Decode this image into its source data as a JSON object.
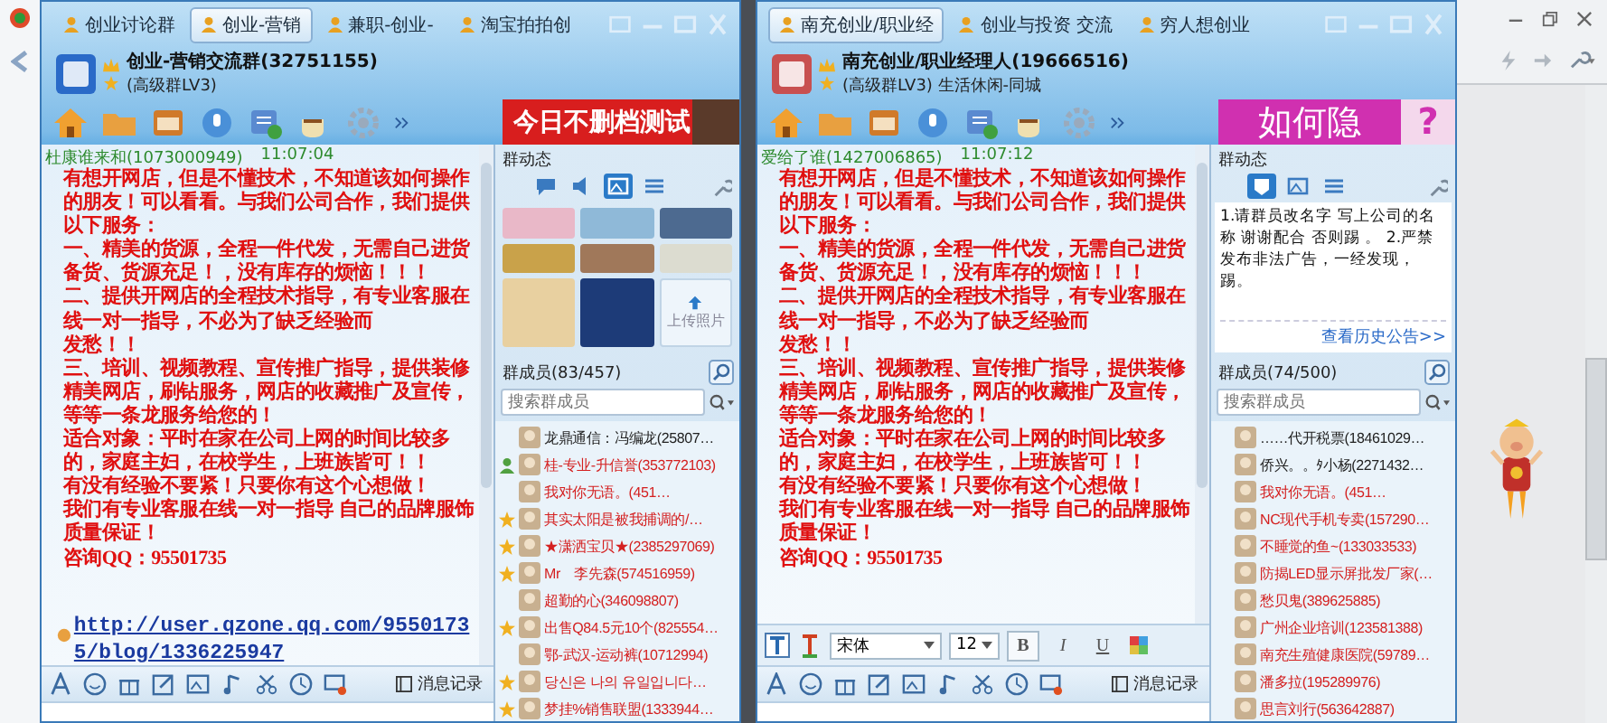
{
  "windows": [
    {
      "tabs": [
        {
          "label": "创业讨论群",
          "selected": false
        },
        {
          "label": "创业-营销",
          "selected": true
        },
        {
          "label": "兼职-创业-",
          "selected": false
        },
        {
          "label": "淘宝拍拍创",
          "selected": false
        }
      ],
      "group_name": "创业-营销交流群(32751155)",
      "group_level": "(高级群LV3)",
      "banner": {
        "kind": "photo",
        "text": "今日不删档测试"
      },
      "message": {
        "sender": "杜康谁来和(1073000949)",
        "time": "11:07:04",
        "paragraphs": [
          "有想开网店，但是不懂技术，不知道该如何操作的朋友！可以看看。与我们公司合作，我们提供以下服务：",
          "一、精美的货源，全程一件代发，无需自己进货备货、货源充足！，没有库存的烦恼！！！",
          "二、提供开网店的全程技术指导，有专业客服在线一对一指导，不必为了缺乏经验而",
          "发愁！！",
          "三、培训、视频教程、宣传推广指导，提供装修精美网店，刷钻服务，网店的收藏推广及宣传，等等一条龙服务给您的！",
          "适合对象：平时在家在公司上网的时间比较多的，家庭主妇，在校学生，上班族皆可！！",
          "有没有经验不要紧！只要你有这个心想做！",
          "我们有专业客服在线一对一指导 自己的品牌服饰质量保证！",
          "咨询QQ：95501735"
        ],
        "link": "http://user.qzone.qq.com/95501735/blog/1336225947"
      },
      "history_label": "消息记录",
      "side": {
        "title": "群动态",
        "panel_tabs": [
          {
            "kind": "chat",
            "selected": false
          },
          {
            "kind": "voice",
            "selected": false
          },
          {
            "kind": "photo",
            "selected": true
          },
          {
            "kind": "list",
            "selected": false
          }
        ],
        "content": {
          "kind": "gallery",
          "tiles": [
            {
              "kind": "photo"
            },
            {
              "kind": "photo"
            },
            {
              "kind": "photo"
            },
            {
              "kind": "photo"
            },
            {
              "kind": "photo"
            },
            {
              "kind": "photo"
            },
            {
              "kind": "photo"
            },
            {
              "kind": "photo"
            }
          ],
          "upload_label": "上传照片"
        },
        "members_title": "群成员(83/457)",
        "search_placeholder": "搜索群成员",
        "members": [
          {
            "name": "龙鼎通信：冯编龙(25807…",
            "kind": "plain",
            "color": "#222222"
          },
          {
            "name": "桂-专业-升信誉(353772103)",
            "kind": "person",
            "color": "#d42020"
          },
          {
            "name": "我对你无语。(451…",
            "kind": "plain",
            "color": "#d42020"
          },
          {
            "name": "其实太阳是被我捕调的/…",
            "kind": "star",
            "color": "#d42020"
          },
          {
            "name": "★潇洒宝贝★(2385297069)",
            "kind": "star",
            "color": "#d42020"
          },
          {
            "name": "Mr　李先森(574516959)",
            "kind": "star",
            "color": "#d42020"
          },
          {
            "name": "超勤的心(346098807)",
            "kind": "plain",
            "color": "#d42020"
          },
          {
            "name": "出售Q84.5元10个(825554…",
            "kind": "star",
            "color": "#d42020"
          },
          {
            "name": "鄂-武汉-运动裤(10712994)",
            "kind": "plain",
            "color": "#d42020"
          },
          {
            "name": "당신은 나의 유일입니다…",
            "kind": "star",
            "color": "#d42020"
          },
          {
            "name": "梦挂%销售联盟(1333944…",
            "kind": "star",
            "color": "#d42020"
          }
        ]
      }
    },
    {
      "tabs": [
        {
          "label": "南充创业/职业经",
          "selected": true
        },
        {
          "label": "创业与投资 交流",
          "selected": false
        },
        {
          "label": "穷人想创业",
          "selected": false
        }
      ],
      "group_name": "南充创业/职业经理人(19666516)",
      "group_level": "(高级群LV3) 生活休闲-同城",
      "banner": {
        "kind": "question",
        "text": "如何隐",
        "mark": "?"
      },
      "message": {
        "sender": "爱给了谁(1427006865)",
        "time": "11:07:12",
        "paragraphs": [
          "有想开网店，但是不懂技术，不知道该如何操作的朋友！可以看看。与我们公司合作，我们提供以下服务：",
          "一、精美的货源，全程一件代发，无需自己进货备货、货源充足！，没有库存的烦恼！！！",
          "二、提供开网店的全程技术指导，有专业客服在线一对一指导，不必为了缺乏经验而",
          "发愁！！",
          "三、培训、视频教程、宣传推广指导，提供装修精美网店，刷钻服务，网店的收藏推广及宣传，等等一条龙服务给您的！",
          "适合对象：平时在家在公司上网的时间比较多的，家庭主妇，在校学生，上班族皆可！！",
          "有没有经验不要紧！只要你有这个心想做！",
          "我们有专业客服在线一对一指导 自己的品牌服饰质量保证！",
          "咨询QQ：95501735"
        ]
      },
      "format_bar": {
        "font": "宋体",
        "size": "12",
        "buttons": [
          "B",
          "I",
          "U"
        ]
      },
      "history_label": "消息记录",
      "side": {
        "title": "群动态",
        "panel_tabs": [
          {
            "kind": "notice",
            "selected": true
          },
          {
            "kind": "photo",
            "selected": false
          },
          {
            "kind": "list",
            "selected": false
          }
        ],
        "content": {
          "kind": "notice",
          "text": "1.请群员改名字 写上公司的名称 谢谢配合 否则踢 。 2.严禁发布非法广告，一经发现，踢。",
          "more_link": "查看历史公告>>"
        },
        "members_title": "群成员(74/500)",
        "search_placeholder": "搜索群成员",
        "members": [
          {
            "name": "……代开税票(18461029…",
            "kind": "plain",
            "color": "#222222"
          },
          {
            "name": "侨兴。。ﾀ小杨(2271432…",
            "kind": "plain",
            "color": "#222222"
          },
          {
            "name": "我对你无语。(451…",
            "kind": "plain",
            "color": "#d42020"
          },
          {
            "name": "NC现代手机专卖(157290…",
            "kind": "plain",
            "color": "#d42020"
          },
          {
            "name": "不睡觉的鱼~(133033533)",
            "kind": "plain",
            "color": "#d42020"
          },
          {
            "name": "防揭LED显示屏批发厂家(…",
            "kind": "plain",
            "color": "#d42020"
          },
          {
            "name": "愁贝鬼(389625885)",
            "kind": "plain",
            "color": "#d42020"
          },
          {
            "name": "广州企业培训(123581388)",
            "kind": "plain",
            "color": "#d42020"
          },
          {
            "name": "南充生殖健康医院(59789…",
            "kind": "plain",
            "color": "#d42020"
          },
          {
            "name": "潘多拉(195289976)",
            "kind": "plain",
            "color": "#d42020"
          },
          {
            "name": "思言刘行(563642887)",
            "kind": "plain",
            "color": "#d42020"
          }
        ]
      }
    }
  ]
}
